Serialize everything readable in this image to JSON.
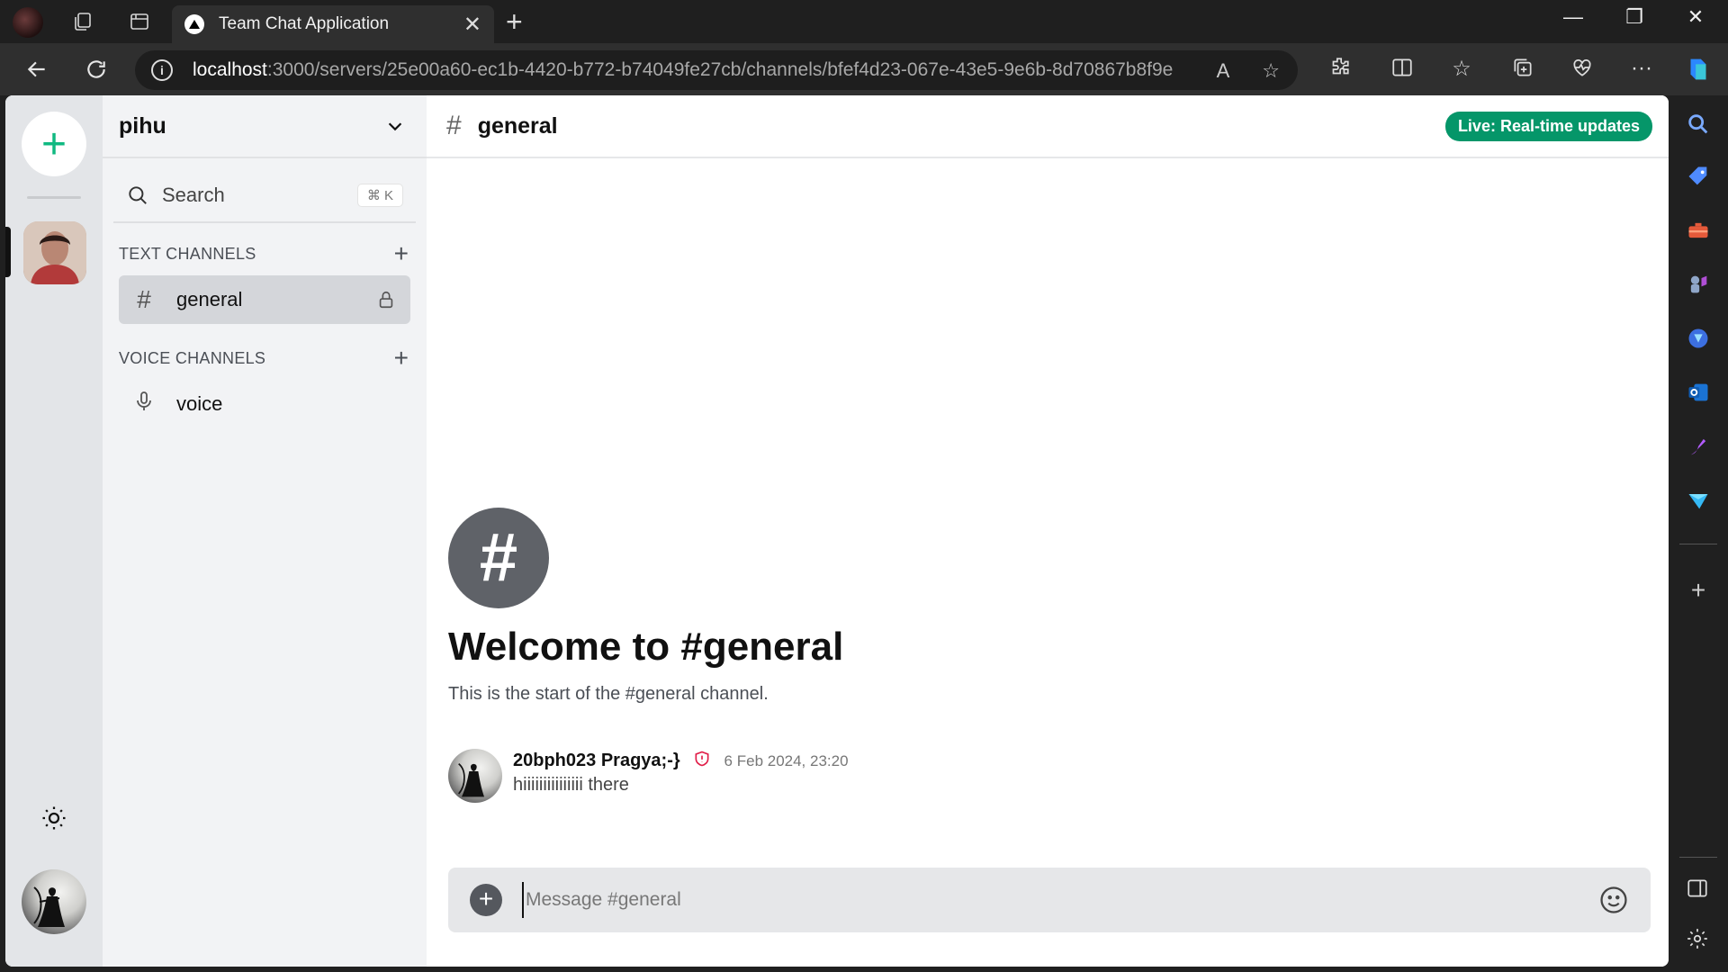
{
  "browser": {
    "tab_title": "Team Chat Application",
    "url_host": "localhost",
    "url_path": ":3000/servers/25e00a60-ec1b-4420-b772-b74049fe27cb/channels/bfef4d23-067e-43e5-9e6b-8d70867b8f9e",
    "accent": "#10b981"
  },
  "server": {
    "name": "pihu"
  },
  "search": {
    "label": "Search",
    "shortcut": "⌘ K"
  },
  "sections": {
    "text_label": "TEXT CHANNELS",
    "voice_label": "VOICE CHANNELS"
  },
  "channels": {
    "text": [
      {
        "name": "general"
      }
    ],
    "voice": [
      {
        "name": "voice"
      }
    ]
  },
  "header": {
    "channel_name": "general",
    "live_badge": "Live: Real-time updates",
    "live_color": "#059669"
  },
  "welcome": {
    "title": "Welcome to #general",
    "subtitle": "This is the start of the #general channel."
  },
  "messages": [
    {
      "author": "20bph023 Pragya;-}",
      "timestamp": "6 Feb 2024, 23:20",
      "text": "hiiiiiiiiiiiiiii there",
      "role_icon": "shield-alert-icon"
    }
  ],
  "composer": {
    "placeholder": "Message #general"
  }
}
